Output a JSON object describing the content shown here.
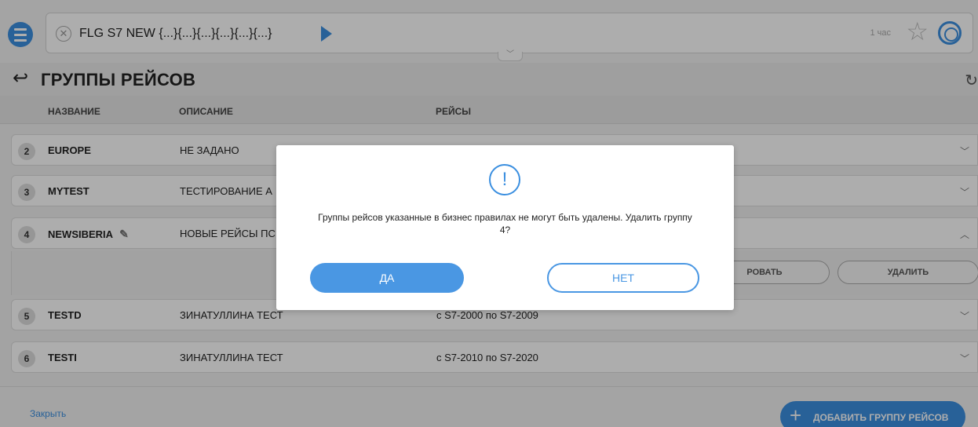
{
  "topbar": {
    "query": "FLG S7 NEW {...}{...}{...}{...}{...}{...}",
    "time_label": "1 час"
  },
  "header": {
    "title": "ГРУППЫ РЕЙСОВ"
  },
  "columns": {
    "name": "НАЗВАНИЕ",
    "description": "ОПИСАНИЕ",
    "flights": "РЕЙСЫ"
  },
  "rows": [
    {
      "num": "2",
      "name": "EUROPE",
      "desc": "НЕ ЗАДАНО",
      "flights": ""
    },
    {
      "num": "3",
      "name": "MYTEST",
      "desc": "ТЕСТИРОВАНИЕ А",
      "flights": ""
    },
    {
      "num": "4",
      "name": "NEWSIBERIA",
      "desc": "НОВЫЕ РЕЙСЫ ПС",
      "flights": ""
    },
    {
      "num": "5",
      "name": "TESTD",
      "desc": "ЗИНАТУЛЛИНА ТЕСТ",
      "flights": "с S7-2000 по S7-2009"
    },
    {
      "num": "6",
      "name": "TESTI",
      "desc": "ЗИНАТУЛЛИНА ТЕСТ",
      "flights": "с S7-2010 по S7-2020"
    }
  ],
  "expanded": {
    "edit_label": "РОВАТЬ",
    "delete_label": "УДАЛИТЬ"
  },
  "footer": {
    "close_label": "Закрыть",
    "add_label": "ДОБАВИТЬ ГРУППУ РЕЙСОВ"
  },
  "dialog": {
    "message_line1": "Группы рейсов указанные в бизнес правилах не могут быть удалены. Удалить группу",
    "message_line2": "4?",
    "yes_label": "ДА",
    "no_label": "НЕТ"
  },
  "colors": {
    "accent": "#3b8fe0"
  }
}
